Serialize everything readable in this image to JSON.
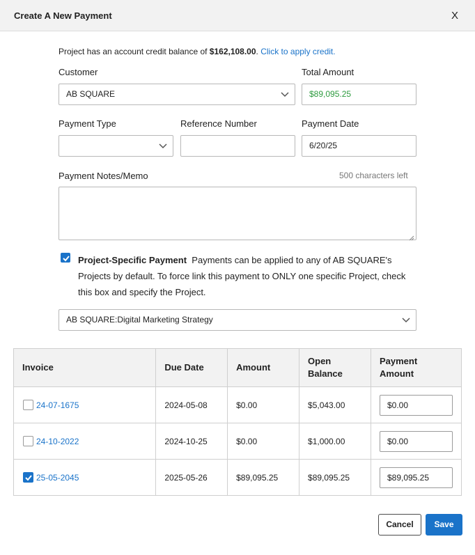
{
  "dialog": {
    "title": "Create A New Payment",
    "close_label": "X"
  },
  "credit": {
    "prefix": "Project has an account credit balance of ",
    "amount": "$162,108.00",
    "suffix": ".",
    "link": "Click to apply credit."
  },
  "form": {
    "customer_label": "Customer",
    "customer_value": "AB SQUARE",
    "total_label": "Total Amount",
    "total_value": "$89,095.25",
    "payment_type_label": "Payment Type",
    "payment_type_value": "",
    "reference_label": "Reference Number",
    "reference_value": "",
    "date_label": "Payment Date",
    "date_value": "6/20/25",
    "notes_label": "Payment Notes/Memo",
    "notes_value": "",
    "chars_left": "500 characters left"
  },
  "project_specific": {
    "checked": true,
    "title": "Project-Specific Payment",
    "description": "Payments can be applied to any of AB SQUARE's Projects by default. To force link this payment to ONLY one specific Project, check this box and specify the Project.",
    "project_value": "AB SQUARE:Digital Marketing Strategy"
  },
  "table": {
    "headers": [
      "Invoice",
      "Due Date",
      "Amount",
      "Open Balance",
      "Payment Amount"
    ],
    "rows": [
      {
        "checked": false,
        "invoice": "24-07-1675",
        "due_date": "2024-05-08",
        "amount": "$0.00",
        "open_balance": "$5,043.00",
        "payment": "$0.00"
      },
      {
        "checked": false,
        "invoice": "24-10-2022",
        "due_date": "2024-10-25",
        "amount": "$0.00",
        "open_balance": "$1,000.00",
        "payment": "$0.00"
      },
      {
        "checked": true,
        "invoice": "25-05-2045",
        "due_date": "2025-05-26",
        "amount": "$89,095.25",
        "open_balance": "$89,095.25",
        "payment": "$89,095.25"
      }
    ]
  },
  "buttons": {
    "cancel": "Cancel",
    "save": "Save"
  },
  "colors": {
    "accent": "#1a73c9",
    "total_amount_text": "#2e9b3f",
    "header_bg": "#f2f2f2"
  },
  "icons": [
    "close-icon",
    "chevron-down-icon",
    "checkmark-icon",
    "resize-grip-icon"
  ]
}
